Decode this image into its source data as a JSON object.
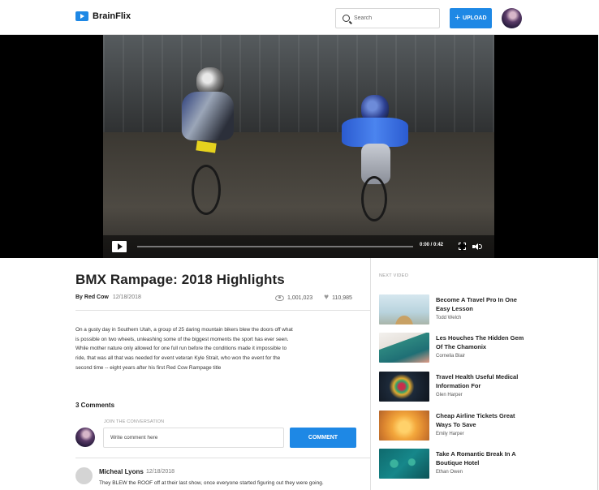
{
  "brand": {
    "name": "BrainFlix",
    "accent_color": "#1e88e5"
  },
  "header": {
    "search_placeholder": "Search",
    "upload_label": "UPLOAD",
    "upload_icon": "plus-icon",
    "avatar_icon": "user-avatar"
  },
  "player": {
    "time": "0:00 / 0:42",
    "progress": 0,
    "controls": [
      "play-icon",
      "fullscreen-icon",
      "volume-icon"
    ]
  },
  "video": {
    "title": "BMX Rampage: 2018 Highlights",
    "author": "By Red Cow",
    "date": "12/18/2018",
    "views": "1,001,023",
    "likes": "110,985",
    "description": "On a gusty day in Southern Utah, a group of 25 daring mountain bikers blew the doors off what is possible on two wheels, unleashing some of the biggest moments the sport has ever seen. While mother nature only allowed for one full run before the conditions made it impossible to ride, that was all that was needed for event veteran Kyle Strait, who won the event for the second time -- eight years after his first Red Cow Rampage title"
  },
  "comments": {
    "count_label": "3 Comments",
    "join_label": "JOIN THE CONVERSATION",
    "input_placeholder": "Write comment here",
    "submit_label": "COMMENT",
    "items": [
      {
        "name": "Micheal Lyons",
        "date": "12/18/2018",
        "text": "They BLEW the ROOF off at their last show, once everyone started figuring out they were going."
      }
    ]
  },
  "sidebar": {
    "heading": "NEXT VIDEO",
    "items": [
      {
        "title": "Become A Travel Pro In One Easy Lesson",
        "author": "Todd Welch"
      },
      {
        "title": "Les Houches The Hidden Gem Of The Chamonix",
        "author": "Cornelia Blair"
      },
      {
        "title": "Travel Health Useful Medical Information For",
        "author": "Glen Harper"
      },
      {
        "title": "Cheap Airline Tickets Great Ways To Save",
        "author": "Emily Harper"
      },
      {
        "title": "Take A Romantic Break In A Boutique Hotel",
        "author": "Ethan Owen"
      }
    ]
  }
}
